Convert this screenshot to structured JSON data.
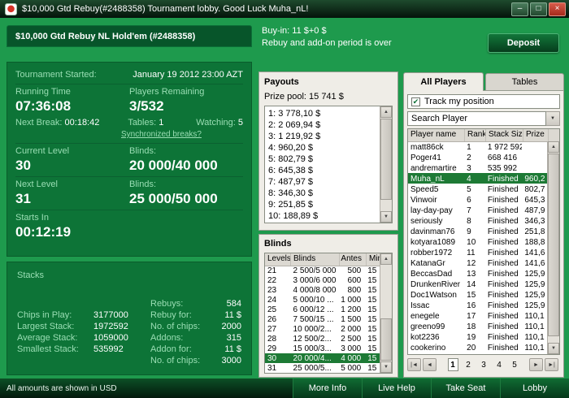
{
  "window": {
    "title": "$10,000 Gtd Rebuy(#2488358) Tournament lobby. Good Luck Muha_nL!",
    "minimize": "–",
    "maximize": "□",
    "close": "×"
  },
  "header": {
    "tournament_name": "$10,000 Gtd Rebuy NL Hold'em (#2488358)",
    "buyin": "Buy-in: 11 $+0 $",
    "rebuy_status": "Rebuy and add-on period is over",
    "deposit": "Deposit"
  },
  "info": {
    "started_label": "Tournament Started:",
    "started_value": "January 19 2012  23:00 AZT",
    "running_time_label": "Running Time",
    "running_time": "07:36:08",
    "players_remaining_label": "Players Remaining",
    "players_remaining": "3/532",
    "next_break_label": "Next Break:",
    "next_break": "00:18:42",
    "tables_label": "Tables:",
    "tables": "1",
    "watching_label": "Watching:",
    "watching": "5",
    "sync_link": "Synchronized breaks?",
    "current_level_label": "Current Level",
    "current_level": "30",
    "blinds_label": "Blinds:",
    "current_blinds": "20 000/40 000",
    "next_level_label": "Next Level",
    "next_level": "31",
    "next_blinds": "25 000/50 000",
    "starts_in_label": "Starts In",
    "starts_in": "00:12:19"
  },
  "stacks": {
    "title": "Stacks",
    "left_rows": [
      {
        "label": "Chips in Play:",
        "value": "3177000"
      },
      {
        "label": "Largest Stack:",
        "value": "1972592"
      },
      {
        "label": "Average Stack:",
        "value": "1059000"
      },
      {
        "label": "Smallest Stack:",
        "value": "535992"
      }
    ],
    "right_rows": [
      {
        "label": "Rebuys:",
        "value": "584"
      },
      {
        "label": "Rebuy for:",
        "value": "11 $"
      },
      {
        "label": "No. of chips:",
        "value": "2000"
      },
      {
        "label": "Addons:",
        "value": "315"
      },
      {
        "label": "Addon for:",
        "value": "11 $"
      },
      {
        "label": "No. of chips:",
        "value": "3000"
      }
    ]
  },
  "payouts": {
    "title": "Payouts",
    "prize_pool": "Prize pool: 15 741 $",
    "items": [
      "1: 3 778,10 $",
      "2: 2 069,94 $",
      "3: 1 219,92 $",
      "4: 960,20 $",
      "5: 802,79 $",
      "6: 645,38 $",
      "7: 487,97 $",
      "8: 346,30 $",
      "9: 251,85 $",
      "10: 188,89 $"
    ]
  },
  "blinds": {
    "title": "Blinds",
    "columns": [
      "Levels",
      "Blinds",
      "Antes",
      "Min."
    ],
    "rows": [
      [
        "21",
        "2 500/5 000",
        "500",
        "15"
      ],
      [
        "22",
        "3 000/6 000",
        "600",
        "15"
      ],
      [
        "23",
        "4 000/8 000",
        "800",
        "15"
      ],
      [
        "24",
        "5 000/10 ...",
        "1 000",
        "15"
      ],
      [
        "25",
        "6 000/12 ...",
        "1 200",
        "15"
      ],
      [
        "26",
        "7 500/15 ...",
        "1 500",
        "15"
      ],
      [
        "27",
        "10 000/2...",
        "2 000",
        "15"
      ],
      [
        "28",
        "12 500/2...",
        "2 500",
        "15"
      ],
      [
        "29",
        "15 000/3...",
        "3 000",
        "15"
      ],
      [
        "30",
        "20 000/4...",
        "4 000",
        "15"
      ],
      [
        "31",
        "25 000/5...",
        "5 000",
        "15"
      ]
    ],
    "highlighted_level": "30"
  },
  "players": {
    "tab_all": "All Players",
    "tab_tables": "Tables",
    "track_label": "Track my position",
    "track_checked": true,
    "search_value": "Search Player",
    "columns": [
      "Player name",
      "Rank",
      "Stack Size",
      "Prize"
    ],
    "rows": [
      {
        "name": "matt86ck",
        "rank": "1",
        "stack": "1 972 592",
        "prize": ""
      },
      {
        "name": "Poger41",
        "rank": "2",
        "stack": "668 416",
        "prize": ""
      },
      {
        "name": "andremartire",
        "rank": "3",
        "stack": "535 992",
        "prize": ""
      },
      {
        "name": "Muha_nL",
        "rank": "4",
        "stack": "Finished",
        "prize": "960,2",
        "highlight": true
      },
      {
        "name": "Speed5",
        "rank": "5",
        "stack": "Finished",
        "prize": "802,7"
      },
      {
        "name": "Vinwoir",
        "rank": "6",
        "stack": "Finished",
        "prize": "645,3"
      },
      {
        "name": "lay-day-pay",
        "rank": "7",
        "stack": "Finished",
        "prize": "487,9"
      },
      {
        "name": "seriously",
        "rank": "8",
        "stack": "Finished",
        "prize": "346,3"
      },
      {
        "name": "davinman76",
        "rank": "9",
        "stack": "Finished",
        "prize": "251,8"
      },
      {
        "name": "kotyara1089",
        "rank": "10",
        "stack": "Finished",
        "prize": "188,8"
      },
      {
        "name": "robber1972",
        "rank": "11",
        "stack": "Finished",
        "prize": "141,6"
      },
      {
        "name": "KatanaGr",
        "rank": "12",
        "stack": "Finished",
        "prize": "141,6"
      },
      {
        "name": "BeccasDad",
        "rank": "13",
        "stack": "Finished",
        "prize": "125,9"
      },
      {
        "name": "DrunkenRiver",
        "rank": "14",
        "stack": "Finished",
        "prize": "125,9"
      },
      {
        "name": "Doc1Watson",
        "rank": "15",
        "stack": "Finished",
        "prize": "125,9"
      },
      {
        "name": "Issac",
        "rank": "16",
        "stack": "Finished",
        "prize": "125,9"
      },
      {
        "name": "enegele",
        "rank": "17",
        "stack": "Finished",
        "prize": "110,1"
      },
      {
        "name": "greeno99",
        "rank": "18",
        "stack": "Finished",
        "prize": "110,1"
      },
      {
        "name": "kot2236",
        "rank": "19",
        "stack": "Finished",
        "prize": "110,1"
      },
      {
        "name": "cookerino",
        "rank": "20",
        "stack": "Finished",
        "prize": "110,1"
      }
    ],
    "pagination": {
      "pages": [
        "1",
        "2",
        "3",
        "4",
        "5"
      ],
      "current": "1"
    }
  },
  "icons": {
    "check": "✔",
    "dropdown": "▼",
    "scroll_up": "▲",
    "scroll_down": "▼",
    "page_first": "|◄",
    "page_prev": "◄",
    "page_next": "►",
    "page_last": "►|"
  },
  "footer": {
    "note": "All amounts are shown in USD",
    "buttons": [
      "More Info",
      "Live Help",
      "Take Seat",
      "Lobby"
    ]
  },
  "colors": {
    "app_background": "#1e9a4d",
    "panel_green": "#0d7437",
    "highlight_green": "#1d7a35",
    "accent_text": "#9adeb4"
  }
}
